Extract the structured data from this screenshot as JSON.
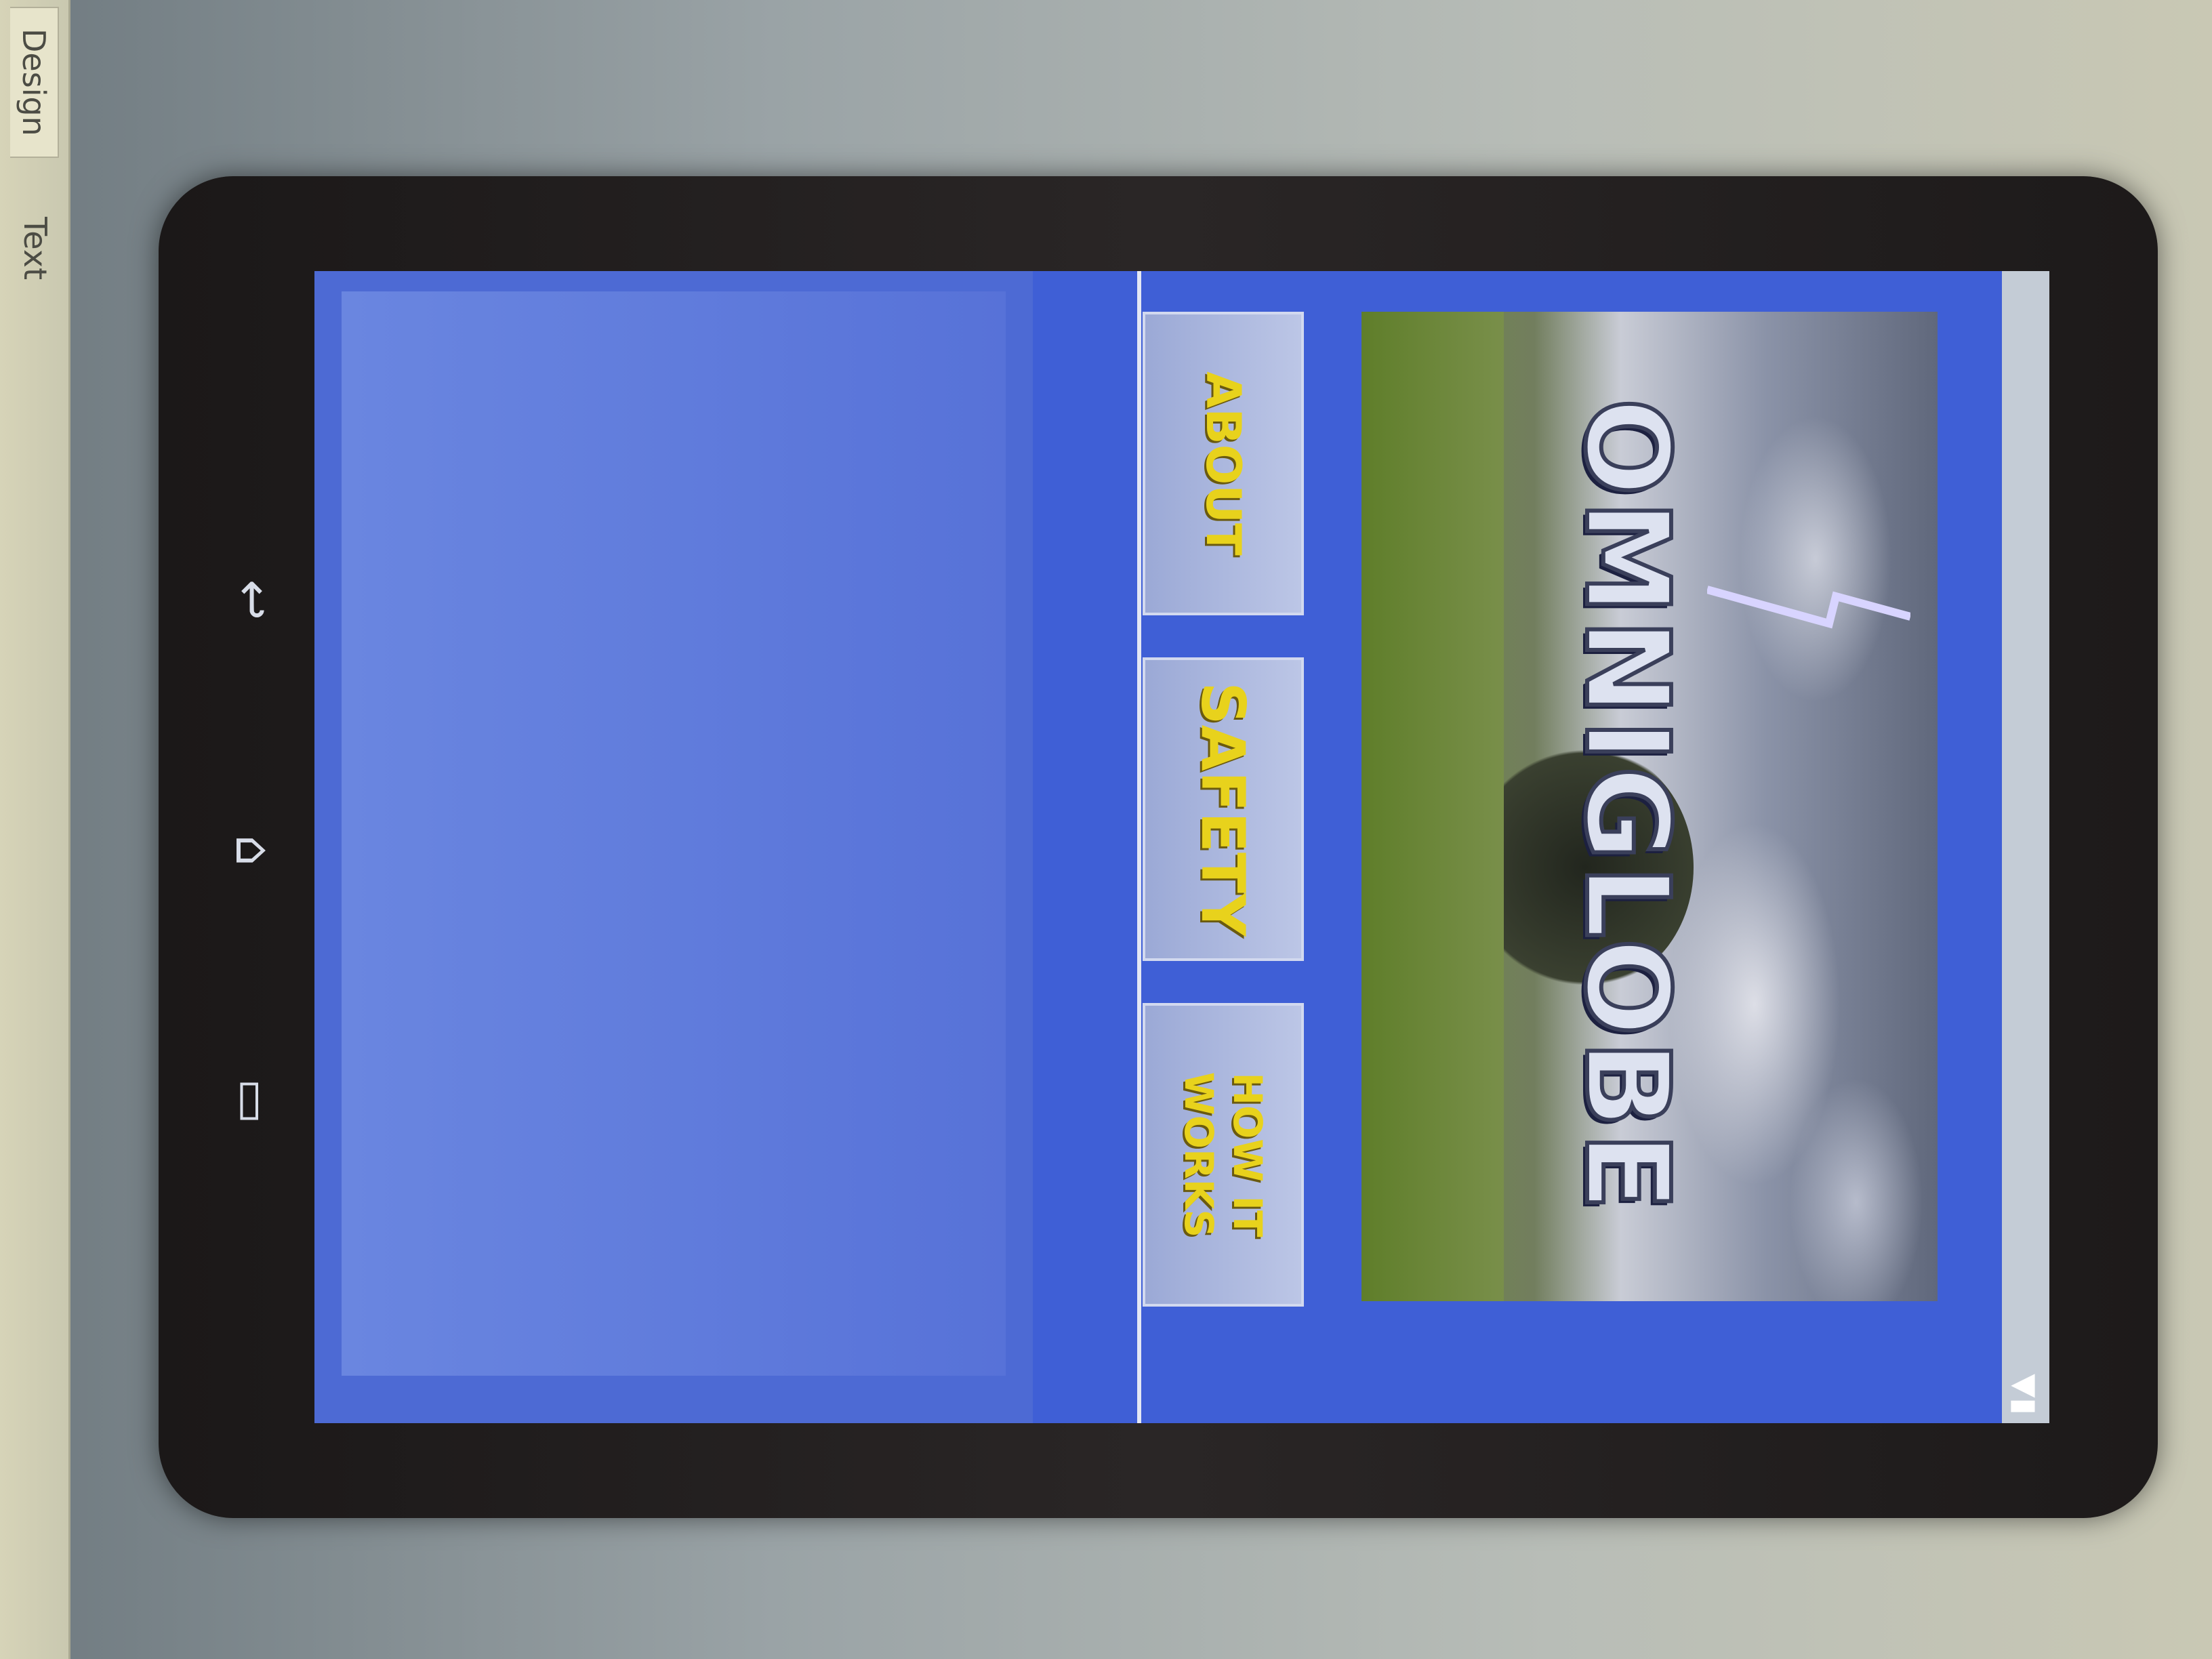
{
  "ide": {
    "tabs": [
      {
        "label": "Design"
      },
      {
        "label": "Text"
      }
    ]
  },
  "device": {
    "status_bar": {
      "icons": "▼▮"
    },
    "app": {
      "banner_title": "OMNIGLOBE",
      "nav_buttons": [
        {
          "label": "ABOUT"
        },
        {
          "label": "SAFETY"
        },
        {
          "label": "HOW IT WORKS"
        }
      ]
    },
    "system_nav": {
      "back_icon": "back-icon",
      "home_icon": "home-icon",
      "recents_icon": "recents-icon"
    }
  },
  "colors": {
    "app_background": "#3f5fd6",
    "button_text": "#e8d21c",
    "button_face": "#bcc6e6"
  }
}
